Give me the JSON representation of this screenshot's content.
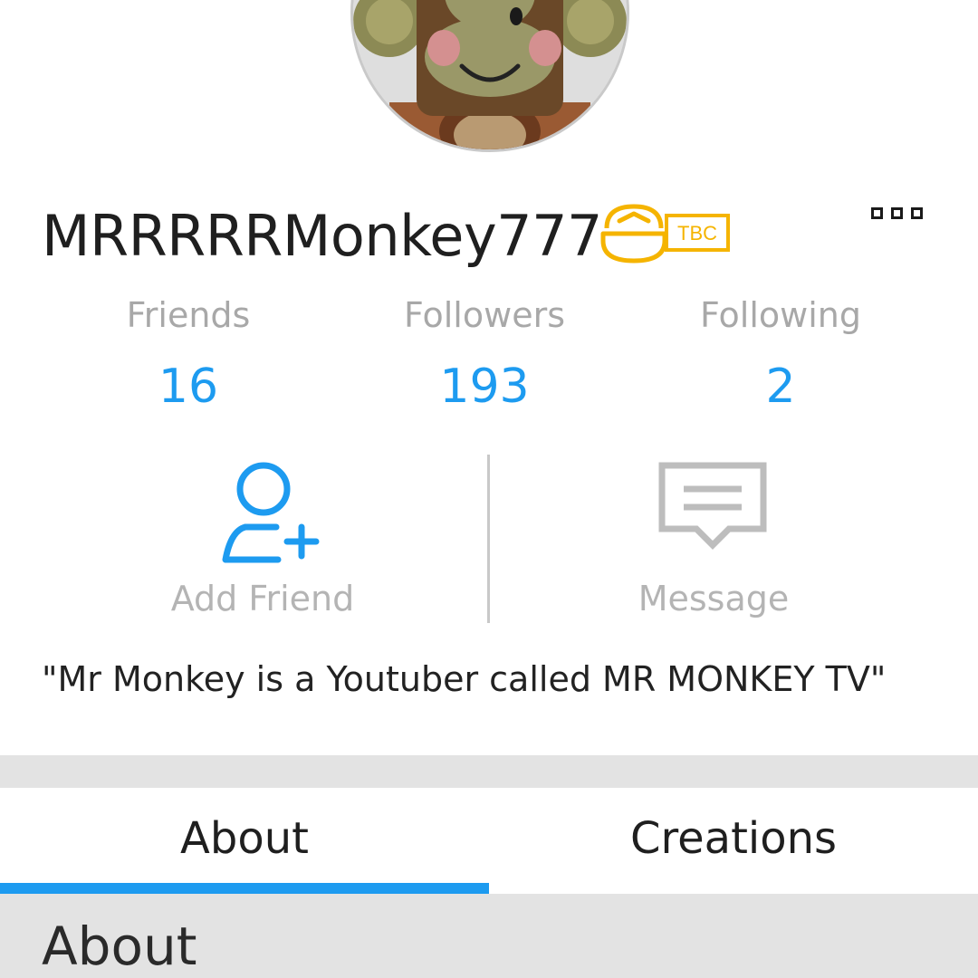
{
  "profile": {
    "username": "MRRRRRMonkey777",
    "membership_icon": "tbc-hardhat-badge",
    "membership_badge_text": "TBC",
    "membership_color": "#f5b400",
    "blurb": "\"Mr Monkey is a Youtuber called MR MONKEY TV\""
  },
  "stats": {
    "friends_label": "Friends",
    "friends_value": "16",
    "followers_label": "Followers",
    "followers_value": "193",
    "following_label": "Following",
    "following_value": "2"
  },
  "actions": {
    "add_friend_label": "Add Friend",
    "add_friend_icon": "add-user-icon",
    "message_label": "Message",
    "message_icon": "message-bubble-icon"
  },
  "tabs": {
    "about_label": "About",
    "creations_label": "Creations",
    "active": "About"
  },
  "about": {
    "heading": "About"
  },
  "colors": {
    "accent": "#1d9bf0",
    "muted_text": "#a8a8a8",
    "band": "#e3e3e3"
  }
}
